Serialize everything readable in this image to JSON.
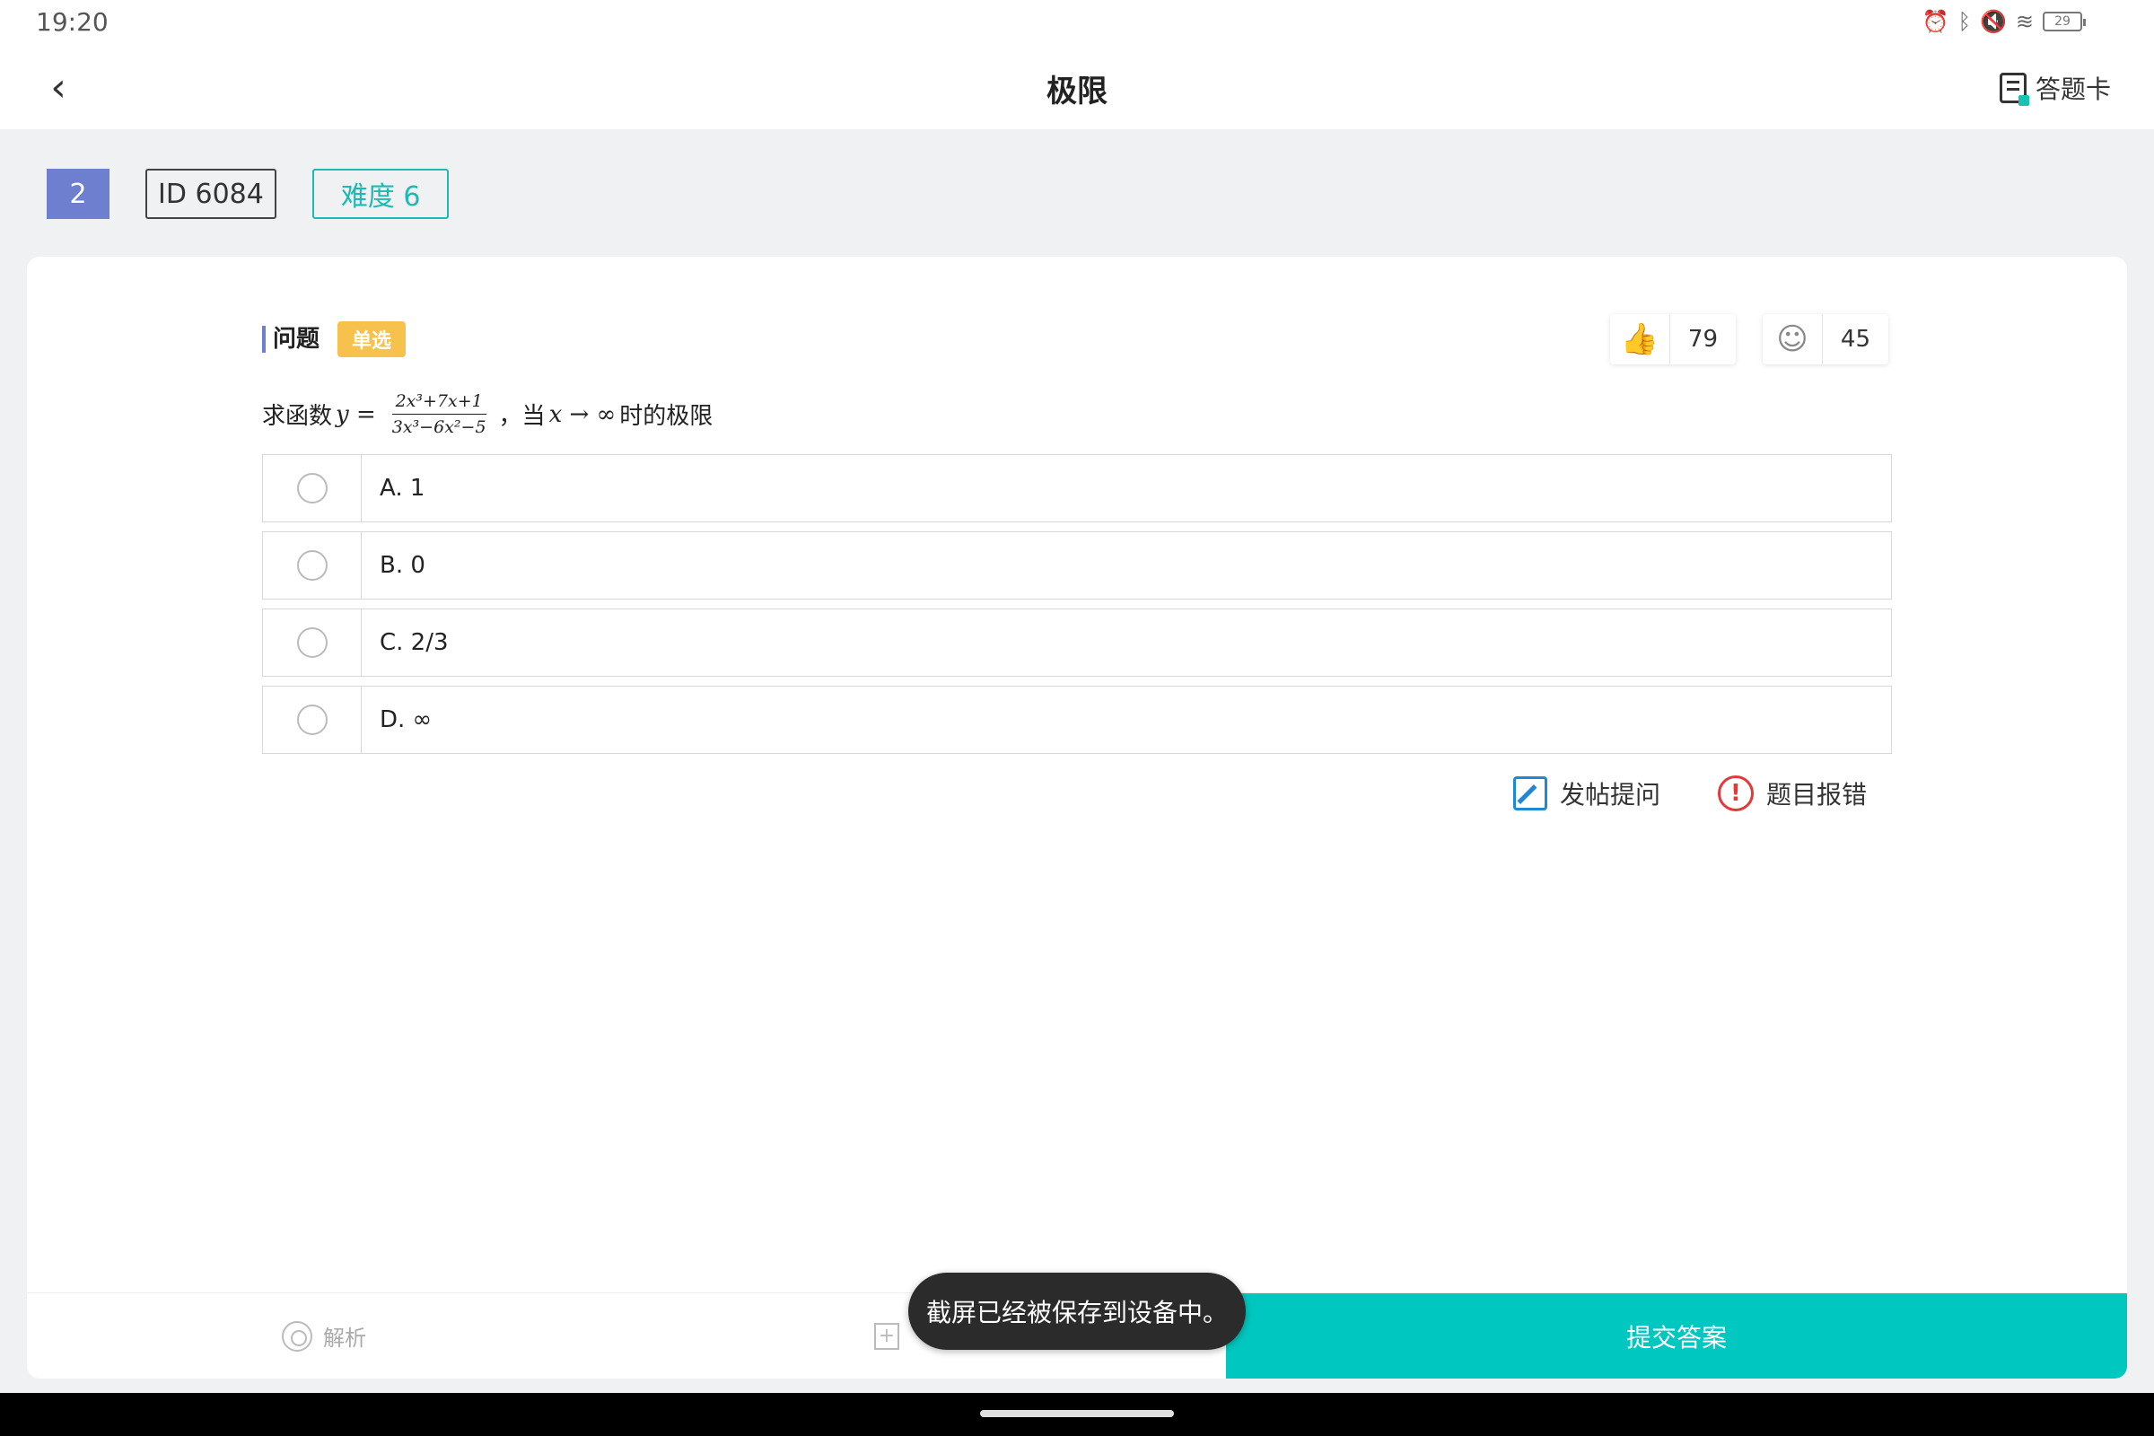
{
  "status": {
    "time": "19:20",
    "battery": "29",
    "icons": [
      "alarm-icon",
      "bluetooth-icon",
      "mute-icon",
      "wifi-icon",
      "battery-icon"
    ]
  },
  "header": {
    "title": "极限",
    "answer_card": "答题卡"
  },
  "tags": {
    "number": "2",
    "id": "ID 6084",
    "difficulty": "难度 6"
  },
  "question": {
    "label": "问题",
    "type": "单选",
    "likes": "79",
    "favorites": "45",
    "prefix": "求函数",
    "y": "y =",
    "numerator": "2x³+7x+1",
    "denominator": "3x³−6x²−5",
    "mid": "，当",
    "x_to_inf": "x → ∞",
    "suffix": "时的极限"
  },
  "options": [
    {
      "label": "A. 1"
    },
    {
      "label": "B. 0"
    },
    {
      "label": "C. 2/3"
    },
    {
      "label": "D. ∞"
    }
  ],
  "actions": {
    "post": "发帖提问",
    "report": "题目报错"
  },
  "bottom": {
    "analysis": "解析",
    "submit": "提交答案"
  },
  "toast": "截屏已经被保存到设备中。",
  "colors": {
    "accent": "#00c7c0",
    "tag_number": "#6e7fcf",
    "type_badge": "#f7c14e",
    "report": "#e03a3a",
    "post": "#1e88d2"
  }
}
